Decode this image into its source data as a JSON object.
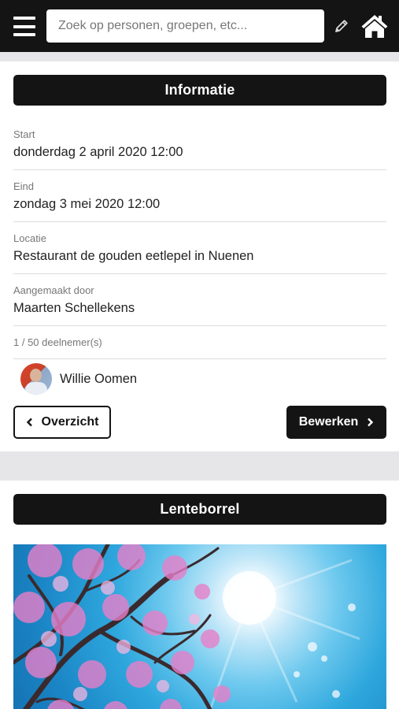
{
  "header": {
    "search_placeholder": "Zoek op personen, groepen, etc...",
    "menu_icon": "hamburger-menu-icon",
    "edit_icon": "pencil-icon",
    "home_icon": "home-icon"
  },
  "info_card": {
    "title": "Informatie",
    "fields": [
      {
        "label": "Start",
        "value": "donderdag 2 april 2020 12:00"
      },
      {
        "label": "Eind",
        "value": "zondag 3 mei 2020 12:00"
      },
      {
        "label": "Locatie",
        "value": "Restaurant de gouden eetlepel in Nuenen"
      },
      {
        "label": "Aangemaakt door",
        "value": "Maarten Schellekens"
      }
    ],
    "participant_count": "1 / 50 deelnemer(s)",
    "participants": [
      {
        "name": "Willie Oomen",
        "avatar_icon": "avatar-photo"
      }
    ],
    "overview_button": "Overzicht",
    "edit_button": "Bewerken"
  },
  "event_card": {
    "title": "Lenteborrel",
    "image": "blossom-tree-sky-photo"
  },
  "colors": {
    "topbar": "#141414",
    "page_bg": "#e6e6e8",
    "title_bar": "#141414",
    "text": "#222222",
    "muted": "#777777"
  }
}
